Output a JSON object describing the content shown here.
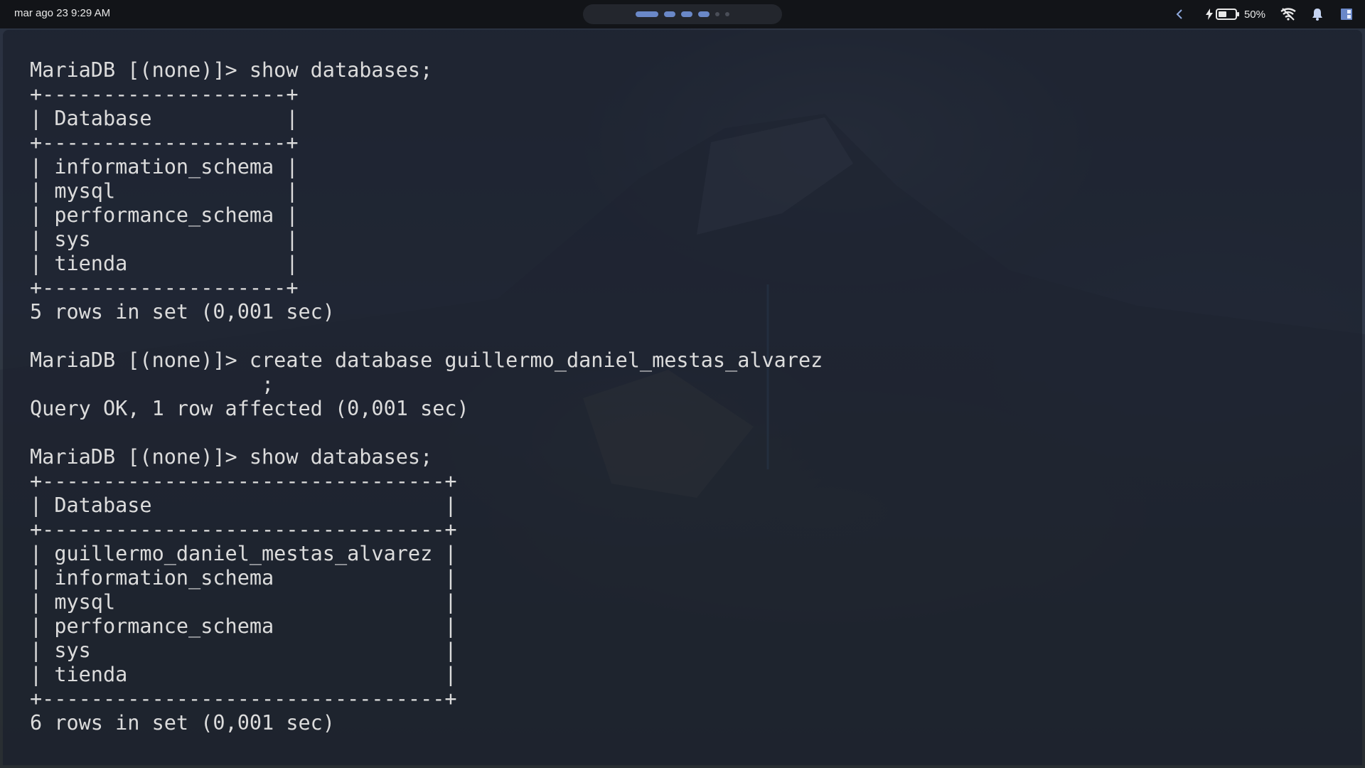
{
  "topbar": {
    "clock": "mar ago 23  9:29 AM",
    "battery_percent": "50%",
    "battery_level": 0.5,
    "workspaces": [
      {
        "state": "active"
      },
      {
        "state": "occupied"
      },
      {
        "state": "occupied"
      },
      {
        "state": "occupied"
      },
      {
        "state": "empty"
      },
      {
        "state": "empty"
      }
    ],
    "icons": {
      "back": "chevron-left-icon",
      "charging": "bolt-icon",
      "battery": "battery-icon",
      "wifi": "wifi-icon",
      "notifications": "bell-icon",
      "panel": "panel-icon"
    },
    "accent": "#6a88c8"
  },
  "terminal": {
    "lines": [
      "MariaDB [(none)]> show databases;",
      "+--------------------+",
      "| Database           |",
      "+--------------------+",
      "| information_schema |",
      "| mysql              |",
      "| performance_schema |",
      "| sys                |",
      "| tienda             |",
      "+--------------------+",
      "5 rows in set (0,001 sec)",
      "",
      "MariaDB [(none)]> create database guillermo_daniel_mestas_alvarez",
      "                   ;",
      "Query OK, 1 row affected (0,001 sec)",
      "",
      "MariaDB [(none)]> show databases;",
      "+---------------------------------+",
      "| Database                        |",
      "+---------------------------------+",
      "| guillermo_daniel_mestas_alvarez |",
      "| information_schema              |",
      "| mysql                           |",
      "| performance_schema              |",
      "| sys                             |",
      "| tienda                          |",
      "+---------------------------------+",
      "6 rows in set (0,001 sec)"
    ]
  }
}
